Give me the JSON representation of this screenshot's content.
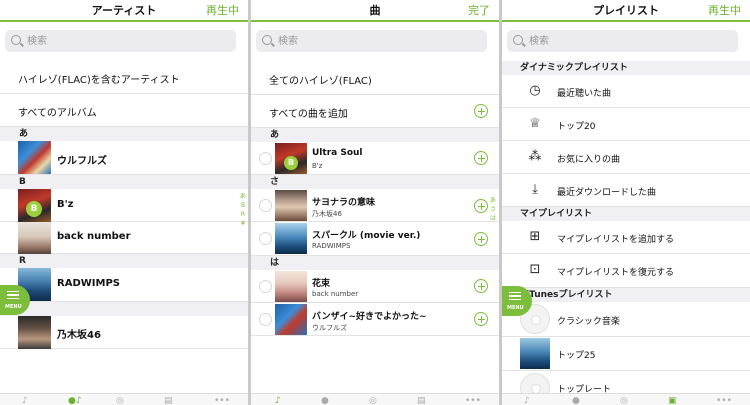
{
  "artists_panel": {
    "title": "アーティスト",
    "action": "再生中",
    "search_placeholder": "検索",
    "hires_row": "ハイレゾ(FLAC)を含むアーティスト",
    "all_albums_row": "すべてのアルバム",
    "sections": [
      {
        "header": "あ",
        "items": [
          "ウルフルズ"
        ]
      },
      {
        "header": "B",
        "items": [
          "B'z",
          "back number"
        ]
      },
      {
        "header": "R",
        "items": [
          "RADWIMPS"
        ]
      },
      {
        "header": "",
        "items": [
          "乃木坂46"
        ]
      }
    ],
    "index": [
      "あ",
      "B",
      "R",
      "#"
    ],
    "menu_label": "MENU"
  },
  "songs_panel": {
    "title": "曲",
    "action": "完了",
    "search_placeholder": "検索",
    "hires_row": "全てのハイレゾ(FLAC)",
    "add_all_row": "すべての曲を追加",
    "sections": [
      {
        "header": "あ",
        "songs": [
          {
            "title": "Ultra Soul",
            "artist": "B'z"
          }
        ]
      },
      {
        "header": "さ",
        "songs": [
          {
            "title": "サヨナラの意味",
            "artist": "乃木坂46"
          },
          {
            "title": "スパークル (movie ver.)",
            "artist": "RADWIMPS"
          }
        ]
      },
      {
        "header": "は",
        "songs": [
          {
            "title": "花束",
            "artist": "back number"
          },
          {
            "title": "バンザイ~好きでよかった~",
            "artist": "ウルフルズ"
          }
        ]
      }
    ],
    "index": [
      "あ",
      "さ",
      "は"
    ]
  },
  "playlists_panel": {
    "title": "プレイリスト",
    "action": "再生中",
    "search_placeholder": "検索",
    "dynamic_header": "ダイナミックプレイリスト",
    "dynamic": [
      "最近聴いた曲",
      "トップ20",
      "お気に入りの曲",
      "最近ダウンロードした曲"
    ],
    "my_header": "マイプレイリスト",
    "my": [
      "マイプレイリストを追加する",
      "マイプレイリストを復元する"
    ],
    "itunes_header": "iTunesプレイリスト",
    "itunes": [
      "クラシック音楽",
      "トップ25",
      "トップレート"
    ],
    "menu_label": "MENU"
  },
  "icons": {
    "recent": "clock-play-icon",
    "top20": "trophy-icon",
    "favorites": "stars-icon",
    "downloads": "download-icon",
    "add_playlist": "add-playlist-icon",
    "restore_playlist": "restore-playlist-icon"
  },
  "colors": {
    "accent": "#7cbd3b",
    "action_text": "#6cb22f",
    "section_bg": "#efeff4"
  }
}
